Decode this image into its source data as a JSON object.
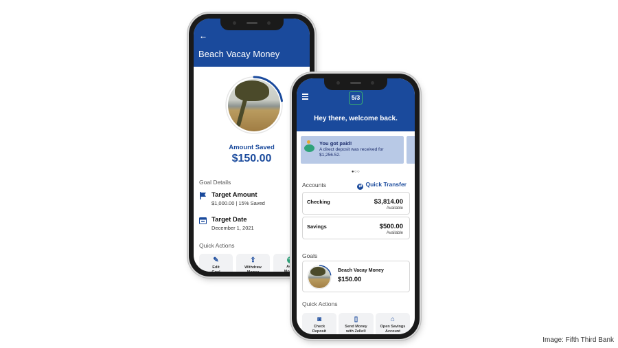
{
  "goal_screen": {
    "back_icon": "arrow-left-icon",
    "title": "Beach Vacay Money",
    "amount_label": "Amount Saved",
    "amount_value": "$150.00",
    "progress_fraction": 0.15,
    "goal_details_label": "Goal Details",
    "target_amount": {
      "icon": "flag-icon",
      "title": "Target Amount",
      "value": "$1,000.00  |  15% Saved"
    },
    "target_date": {
      "icon": "calendar-icon",
      "title": "Target Date",
      "value": "December 1, 2021"
    },
    "quick_actions_label": "Quick Actions",
    "quick_actions": [
      {
        "icon": "pencil-icon",
        "glyph": "✎",
        "line1": "Edit",
        "line2": "Goal"
      },
      {
        "icon": "upload-icon",
        "glyph": "⇪",
        "line1": "Withdraw",
        "line2": "Money"
      },
      {
        "icon": "add-icon",
        "glyph": "+",
        "line1": "Add",
        "line2": "Money"
      }
    ]
  },
  "home_screen": {
    "menu_icon": "hamburger-menu-icon",
    "logo_text": "5/3",
    "welcome": "Hey there, welcome back.",
    "promo": {
      "icon": "piggy-bank-icon",
      "title": "You got paid!",
      "text": "A direct deposit was received for $1,256.52."
    },
    "carousel_dots": "●○○",
    "accounts_label": "Accounts",
    "quick_transfer_label": "Quick Transfer",
    "accounts": [
      {
        "name": "Checking",
        "balance": "$3,814.00",
        "status": "Available"
      },
      {
        "name": "Savings",
        "balance": "$500.00",
        "status": "Available"
      }
    ],
    "goals_label": "Goals",
    "goal": {
      "name": "Beach Vacay Money",
      "amount": "$150.00",
      "progress_fraction": 0.15
    },
    "quick_actions_label": "Quick Actions",
    "quick_actions": [
      {
        "icon": "camera-icon",
        "glyph": "◙",
        "line1": "Check",
        "line2": "Deposit"
      },
      {
        "icon": "phone-icon",
        "glyph": "▯",
        "line1": "Send Money",
        "line2": "with Zelle®"
      },
      {
        "icon": "bank-icon",
        "glyph": "⌂",
        "line1": "Open Savings",
        "line2": "Account"
      }
    ]
  },
  "caption": "Image: Fifth Third Bank",
  "colors": {
    "brand_blue": "#1a4a9c",
    "logo_green": "#3bb36d",
    "promo_bg": "#b8c9e6"
  }
}
